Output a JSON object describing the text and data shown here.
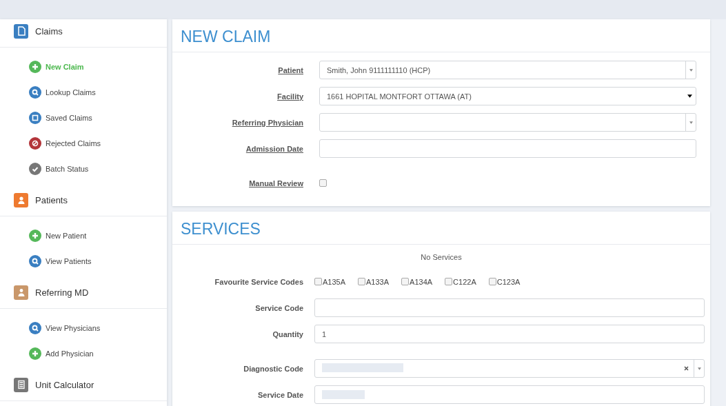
{
  "sidebar": {
    "sections": [
      {
        "title": "Claims",
        "kind": "document",
        "color": "#3a7fc1",
        "items": [
          {
            "label": "New Claim",
            "kind": "add",
            "selected": true
          },
          {
            "label": "Lookup Claims",
            "kind": "search",
            "selected": false
          },
          {
            "label": "Saved Claims",
            "kind": "save",
            "selected": false
          },
          {
            "label": "Rejected Claims",
            "kind": "reject",
            "selected": false
          },
          {
            "label": "Batch Status",
            "kind": "check",
            "selected": false
          }
        ]
      },
      {
        "title": "Patients",
        "kind": "person",
        "color": "#ee7a30",
        "items": [
          {
            "label": "New Patient",
            "kind": "add",
            "selected": false
          },
          {
            "label": "View Patients",
            "kind": "search",
            "selected": false
          }
        ]
      },
      {
        "title": "Referring MD",
        "kind": "doctor",
        "color": "#c9976a",
        "items": [
          {
            "label": "View Physicians",
            "kind": "search",
            "selected": false
          },
          {
            "label": "Add Physician",
            "kind": "add",
            "selected": false
          }
        ]
      },
      {
        "title": "Unit Calculator",
        "kind": "calculator",
        "color": "#777777"
      }
    ]
  },
  "claim": {
    "title": "NEW CLAIM",
    "fields": [
      {
        "label": "Patient",
        "kind": "select",
        "value": "Smith, John 9111111110 (HCP)"
      },
      {
        "label": "Facility",
        "kind": "native",
        "value": "1661 HOPITAL MONTFORT OTTAWA (AT)"
      },
      {
        "label": "Referring Physician",
        "kind": "select"
      },
      {
        "label": "Admission Date",
        "kind": "text"
      },
      {
        "label": "Manual Review",
        "kind": "checkbox",
        "checked": false
      }
    ]
  },
  "services": {
    "title": "SERVICES",
    "empty_text": "No Services",
    "favourites_label": "Favourite Service Codes",
    "favourites": [
      {
        "code": "A135A",
        "checked": false
      },
      {
        "code": "A133A",
        "checked": false
      },
      {
        "code": "A134A",
        "checked": false
      },
      {
        "code": "C122A",
        "checked": false
      },
      {
        "code": "C123A",
        "checked": false
      }
    ],
    "fields": [
      {
        "label": "Service Code",
        "kind": "text"
      },
      {
        "label": "Quantity",
        "kind": "text",
        "value": "1"
      },
      {
        "label": "Diagnostic Code",
        "kind": "clearselect"
      },
      {
        "label": "Service Date",
        "kind": "date"
      }
    ]
  }
}
